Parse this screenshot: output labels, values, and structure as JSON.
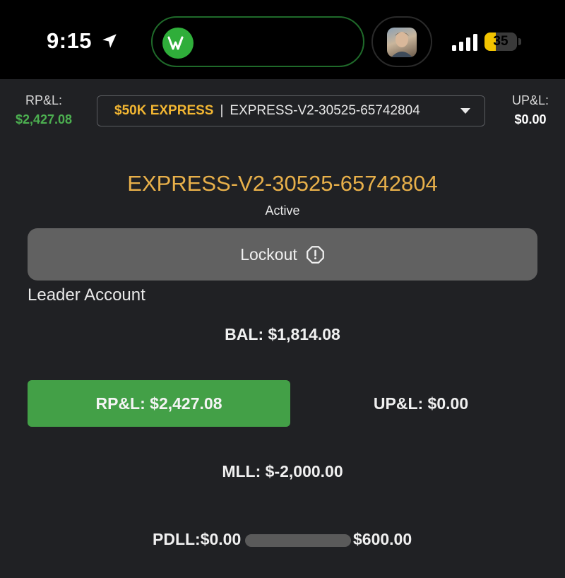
{
  "status_bar": {
    "time": "9:15",
    "battery": "35",
    "battery_level": 0.35,
    "icons": [
      "location-arrow-icon",
      "app-logo-icon",
      "avatar",
      "cell-signal-icon",
      "battery-icon"
    ]
  },
  "header": {
    "left_label": "RP&L:",
    "left_value": "$2,427.08",
    "selector_plan": "$50K EXPRESS",
    "selector_separator": "|",
    "selector_account": "EXPRESS-V2-30525-65742804",
    "right_label": "UP&L:",
    "right_value": "$0.00"
  },
  "account": {
    "title": "EXPRESS-V2-30525-65742804",
    "status": "Active",
    "lockout_label": "Lockout",
    "leader_label": "Leader Account"
  },
  "stats": {
    "bal": "BAL: $1,814.08",
    "rpl": "RP&L: $2,427.08",
    "upl": "UP&L: $0.00",
    "mll": "MLL: $-2,000.00",
    "pdll_label": "PDLL:$0.00",
    "pdll_max": "$600.00",
    "pdll_progress": 0.0
  },
  "colors": {
    "accent_gold": "#e8b04a",
    "plan_gold": "#f2b632",
    "green": "#43a047",
    "lockout_gray": "#616161",
    "background": "#202124"
  }
}
